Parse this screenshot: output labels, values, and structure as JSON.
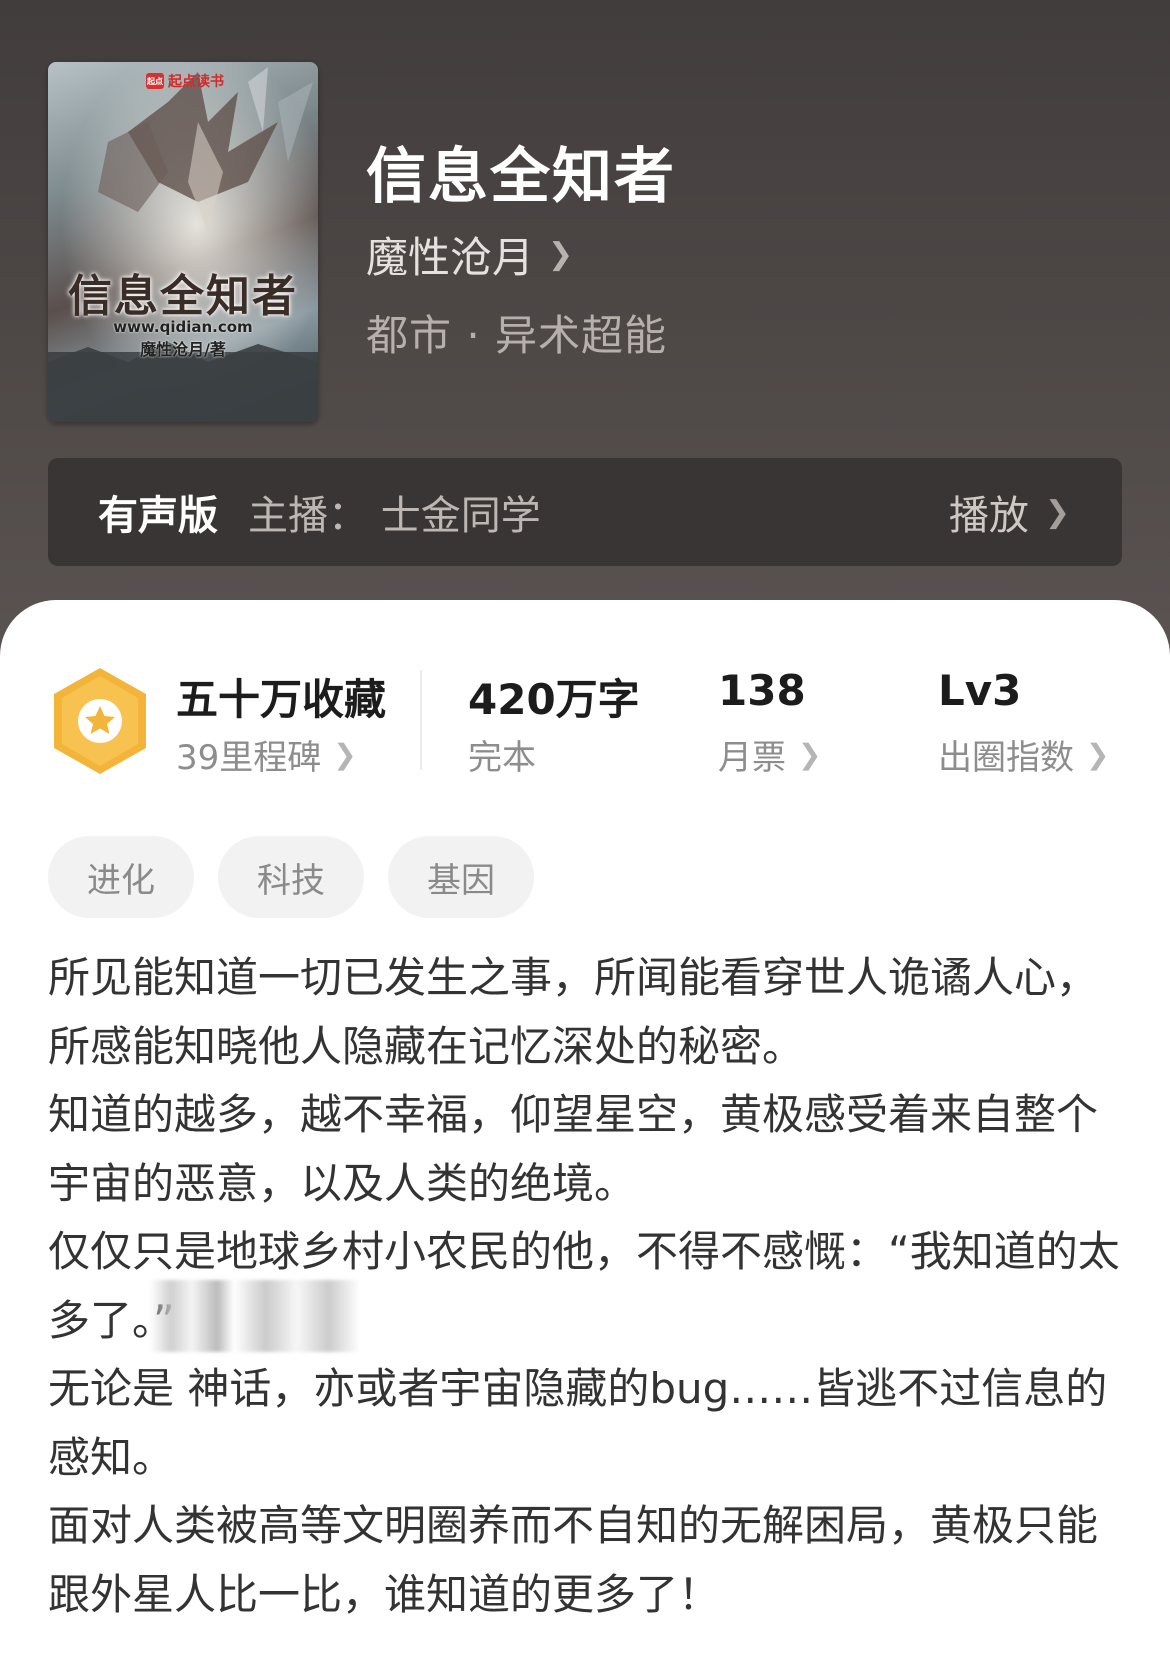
{
  "book": {
    "cover": {
      "brand": "起点读书",
      "brand_logo": "起点",
      "title": "信息全知者",
      "url": "www.qidian.com",
      "author_credit": "魔性沧月/著"
    },
    "title": "信息全知者",
    "author": "魔性沧月",
    "genre": "都市 · 异术超能"
  },
  "audio": {
    "label": "有声版",
    "host": "主播：  士金同学",
    "play_label": "播放"
  },
  "stats": {
    "collections": "五十万收藏",
    "milestones": "39里程碑",
    "word_count": "420万字",
    "status": "完本",
    "monthly_votes": "138",
    "monthly_votes_label": "月票",
    "level": "Lv3",
    "level_label": "出圈指数"
  },
  "tags": [
    "进化",
    "科技",
    "基因"
  ],
  "synopsis": [
    "所见能知道一切已发生之事，所闻能看穿世人诡谲人心，所感能知晓他人隐藏在记忆深处的秘密。",
    "知道的越多，越不幸福，仰望星空，黄极感受着来自整个宇宙的恶意，以及人类的绝境。",
    "仅仅只是地球乡村小农民的他，不得不感慨：“我知道的太多了。”",
    "无论是    神话，亦或者宇宙隐藏的bug……皆逃不过信息的感知。",
    "面对人类被高等文明圈养而不自知的无解困局，黄极只能跟外星人比一比，谁知道的更多了！"
  ],
  "icons": {
    "chevron": "chevron-right-icon",
    "badge": "star-hexagon-icon"
  },
  "colors": {
    "header_bg": "#4a4443",
    "audio_bar_bg": "#3a3535",
    "badge_gold": "#f3b43a",
    "text_dark": "#333333"
  }
}
